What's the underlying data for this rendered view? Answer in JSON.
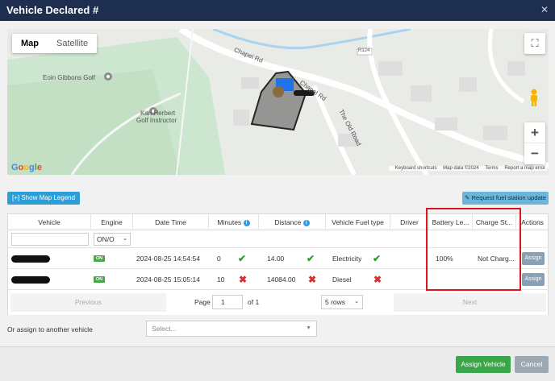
{
  "modal": {
    "title": "Vehicle Declared #",
    "close_icon": "close-icon"
  },
  "map": {
    "tabs": [
      {
        "label": "Map",
        "active": true
      },
      {
        "label": "Satellite",
        "active": false
      }
    ],
    "labels": {
      "golf1": "Eoin Gibbons Golf",
      "golf2_line1": "Karl Herbert",
      "golf2_line2": "Golf Instructor",
      "road1": "Chapel Rd",
      "road2": "Chapel Rd",
      "road3": "The Old Road",
      "road_badge": "R124"
    },
    "zoom_in": "+",
    "zoom_out": "−",
    "logo": "Google",
    "footer": {
      "shortcuts": "Keyboard shortcuts",
      "data": "Map data ©2024",
      "terms": "Terms",
      "report": "Report a map error"
    }
  },
  "buttons": {
    "legend": "[+] Show Map Legend",
    "fuel_update": "Request fuel station update"
  },
  "table": {
    "headers": {
      "vehicle": "Vehicle",
      "engine": "Engine",
      "datetime": "Date Time",
      "minutes": "Minutes",
      "distance": "Distance",
      "fuel_type": "Vehicle Fuel type",
      "driver": "Driver",
      "battery": "Battery Le...",
      "charge": "Charge St...",
      "actions": "Actions"
    },
    "filter": {
      "engine_value": "ON/O"
    },
    "rows": [
      {
        "engine": "ON",
        "datetime": "2024-08-25 14:54:54",
        "minutes": "0",
        "minutes_ok": true,
        "distance": "14.00",
        "distance_ok": true,
        "fuel": "Electricity",
        "fuel_ok": true,
        "battery": "100%",
        "charge": "Not Charg...",
        "action": "Assign"
      },
      {
        "engine": "ON",
        "datetime": "2024-08-25 15:05:14",
        "minutes": "10",
        "minutes_ok": false,
        "distance": "14084.00",
        "distance_ok": false,
        "fuel": "Diesel",
        "fuel_ok": false,
        "battery": "",
        "charge": "",
        "action": "Assign"
      }
    ],
    "pager": {
      "previous": "Previous",
      "page_label": "Page",
      "page_value": "1",
      "of_label": "of 1",
      "rows_value": "5 rows",
      "next": "Next"
    }
  },
  "reassign": {
    "label": "Or assign to another vehicle",
    "placeholder": "Select..."
  },
  "footer": {
    "assign": "Assign Vehicle",
    "cancel": "Cancel"
  },
  "colors": {
    "header": "#1d2e4f",
    "primary": "#2f9ed6",
    "success": "#3aa64a",
    "highlight": "#e0141e"
  }
}
